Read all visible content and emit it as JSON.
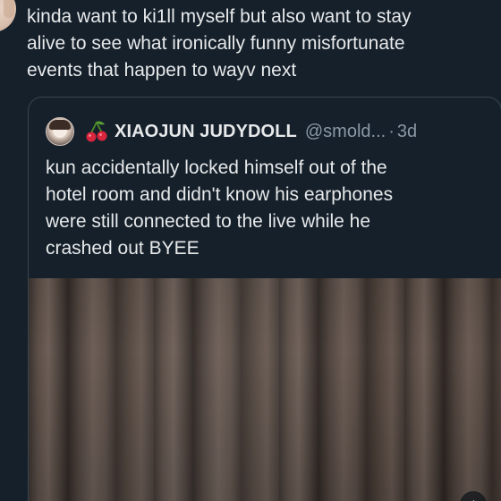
{
  "tweet": {
    "text": "kinda want to ki1ll myself but also want to stay\nalive to see what ironically funny misfortunate\nevents that happen to wayv next"
  },
  "quote": {
    "display_name": "XIAOJUN JUDYDOLL",
    "handle": "@smold...",
    "separator": "·",
    "time": "3d",
    "text": "kun accidentally locked himself out of the\nhotel room and didn't know his earphones\nwere still connected to the live while he\ncrashed out BYEE"
  },
  "icons": {
    "name_emoji": "cherry-icon",
    "media_control": "mute-icon"
  },
  "colors": {
    "background": "#15202b",
    "text_primary": "#e7e9ea",
    "text_secondary": "#8b98a5",
    "border": "#38444d",
    "cherry_red": "#d7263d"
  }
}
